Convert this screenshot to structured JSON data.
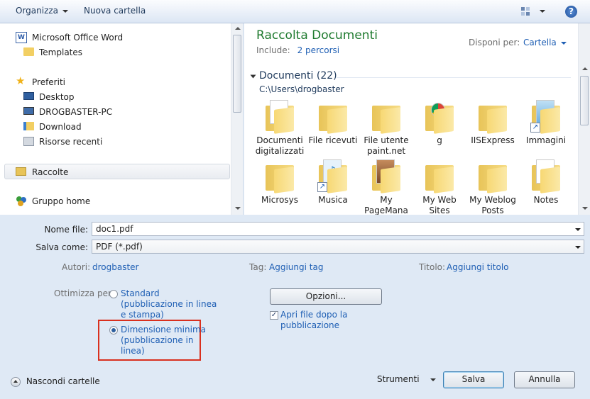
{
  "toolbar": {
    "organize": "Organizza",
    "new_folder": "Nuova cartella",
    "views_icon": "views-icon",
    "help_icon": "help-icon"
  },
  "nav": {
    "items": [
      {
        "label": "Microsoft Office Word",
        "icon": "word-icon"
      },
      {
        "label": "Templates",
        "icon": "folder-icon"
      },
      {
        "label": "Preferiti",
        "icon": "star-icon"
      },
      {
        "label": "Desktop",
        "icon": "desktop-icon"
      },
      {
        "label": "DROGBASTER-PC",
        "icon": "computer-icon"
      },
      {
        "label": "Download",
        "icon": "download-folder-icon"
      },
      {
        "label": "Risorse recenti",
        "icon": "recent-icon"
      },
      {
        "label": "Raccolte",
        "icon": "libraries-icon"
      },
      {
        "label": "Gruppo home",
        "icon": "homegroup-icon"
      }
    ]
  },
  "library": {
    "title": "Raccolta Documenti",
    "include_label": "Include:",
    "include_link": "2 percorsi",
    "arrange_label": "Disponi per:",
    "arrange_value": "Cartella"
  },
  "group": {
    "title": "Documenti (22)",
    "path": "C:\\Users\\drogbaster"
  },
  "folders": [
    {
      "line1": "Documenti",
      "line2": "digitalizzati",
      "type": "doc"
    },
    {
      "line1": "File ricevuti",
      "line2": "",
      "type": "plain"
    },
    {
      "line1": "File utente",
      "line2": "paint.net",
      "type": "plain"
    },
    {
      "line1": "g",
      "line2": "",
      "type": "chrome"
    },
    {
      "line1": "IISExpress",
      "line2": "",
      "type": "plain"
    },
    {
      "line1": "Immagini",
      "line2": "",
      "type": "shortcut-image"
    },
    {
      "line1": "Microsys",
      "line2": "",
      "type": "plain"
    },
    {
      "line1": "Musica",
      "line2": "",
      "type": "shortcut-music"
    },
    {
      "line1": "My",
      "line2": "PageMana",
      "type": "photo"
    },
    {
      "line1": "My Web",
      "line2": "Sites",
      "type": "plain"
    },
    {
      "line1": "My Weblog",
      "line2": "Posts",
      "type": "plain"
    },
    {
      "line1": "Notes",
      "line2": "",
      "type": "doc"
    }
  ],
  "form": {
    "filename_label": "Nome file:",
    "filename_value": "doc1.pdf",
    "saveas_label": "Salva come:",
    "saveas_value": "PDF (*.pdf)",
    "authors_label": "Autori:",
    "authors_value": "drogbaster",
    "tags_label": "Tag:",
    "tags_value": "Aggiungi tag",
    "title_label": "Titolo:",
    "title_value": "Aggiungi titolo",
    "optimize_label": "Ottimizza per:",
    "opt_standard": [
      "Standard",
      "(pubblicazione in linea",
      "e stampa)"
    ],
    "opt_minimum": [
      "Dimensione minima",
      "(pubblicazione in",
      "linea)"
    ],
    "options_button": "Opzioni...",
    "open_after": [
      "Apri file dopo la",
      "pubblicazione"
    ],
    "highlight_color": "#d9301e"
  },
  "footer": {
    "hide_folders": "Nascondi cartelle",
    "tools": "Strumenti",
    "save": "Salva",
    "cancel": "Annulla"
  }
}
